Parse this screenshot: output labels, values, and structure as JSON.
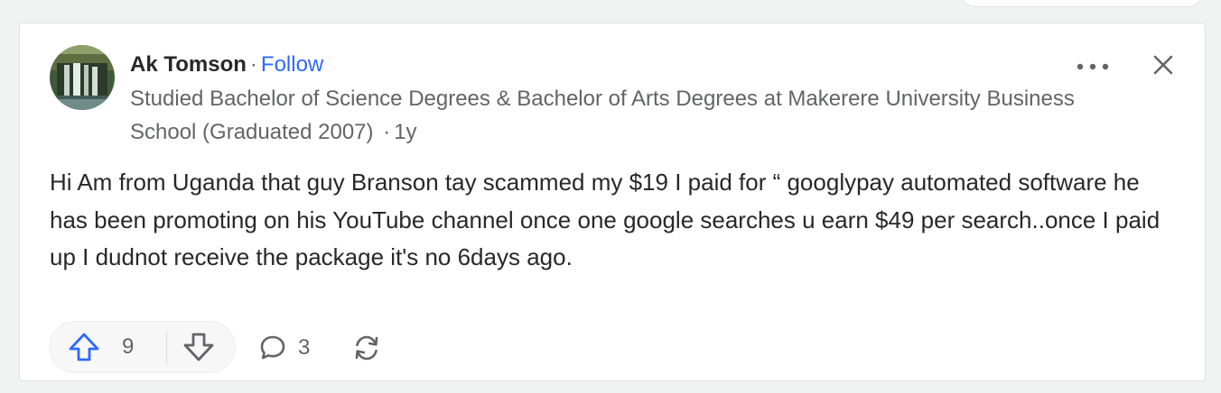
{
  "answer": {
    "author": {
      "name": "Ak Tomson",
      "separator": "·",
      "follow_label": "Follow",
      "credential": "Studied Bachelor of Science Degrees & Bachelor of Arts Degrees at Makerere University Business School (Graduated 2007)",
      "time_separator": "·",
      "time_ago": "1y"
    },
    "body": "Hi Am from Uganda that guy Branson tay scammed my $19 I paid for “ googlypay automated software he has been promoting on his YouTube channel once one google searches u earn $49 per search..once I paid up I dudnot receive the package it's no 6days ago.",
    "actions": {
      "upvote_count": "9",
      "comment_count": "3",
      "upvote_icon": "arrow-up-icon",
      "downvote_icon": "arrow-down-icon",
      "comment_icon": "comment-bubble-icon",
      "share_icon": "share-refresh-icon",
      "more_icon": "more-dots-icon",
      "close_icon": "close-icon"
    },
    "colors": {
      "link_blue": "#2e69ff",
      "text_primary": "#282829",
      "text_secondary": "#636466"
    }
  }
}
